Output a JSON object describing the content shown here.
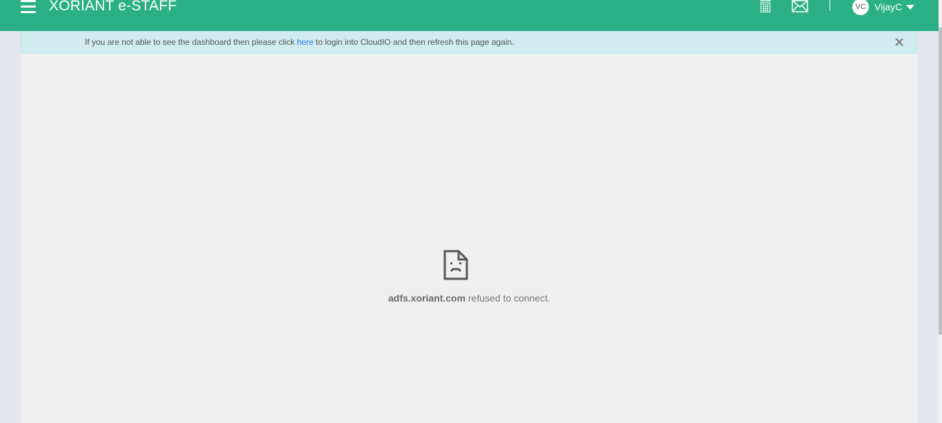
{
  "header": {
    "brand": "XORIANT e-STAFF",
    "icons": [
      "menu-icon",
      "calculator-icon",
      "mail-icon",
      "chevron-down-icon"
    ],
    "user": {
      "initials": "VC",
      "name": "VijayC"
    },
    "color": "#2bb085"
  },
  "alert": {
    "text_before": "If you are not able to see the dashboard then please click ",
    "link_text": "here",
    "text_after": " to login into CloudIO and then refresh this page again.",
    "background": "#d1ecf1"
  },
  "error": {
    "host": "adfs.xoriant.com",
    "message": " refused to connect."
  }
}
